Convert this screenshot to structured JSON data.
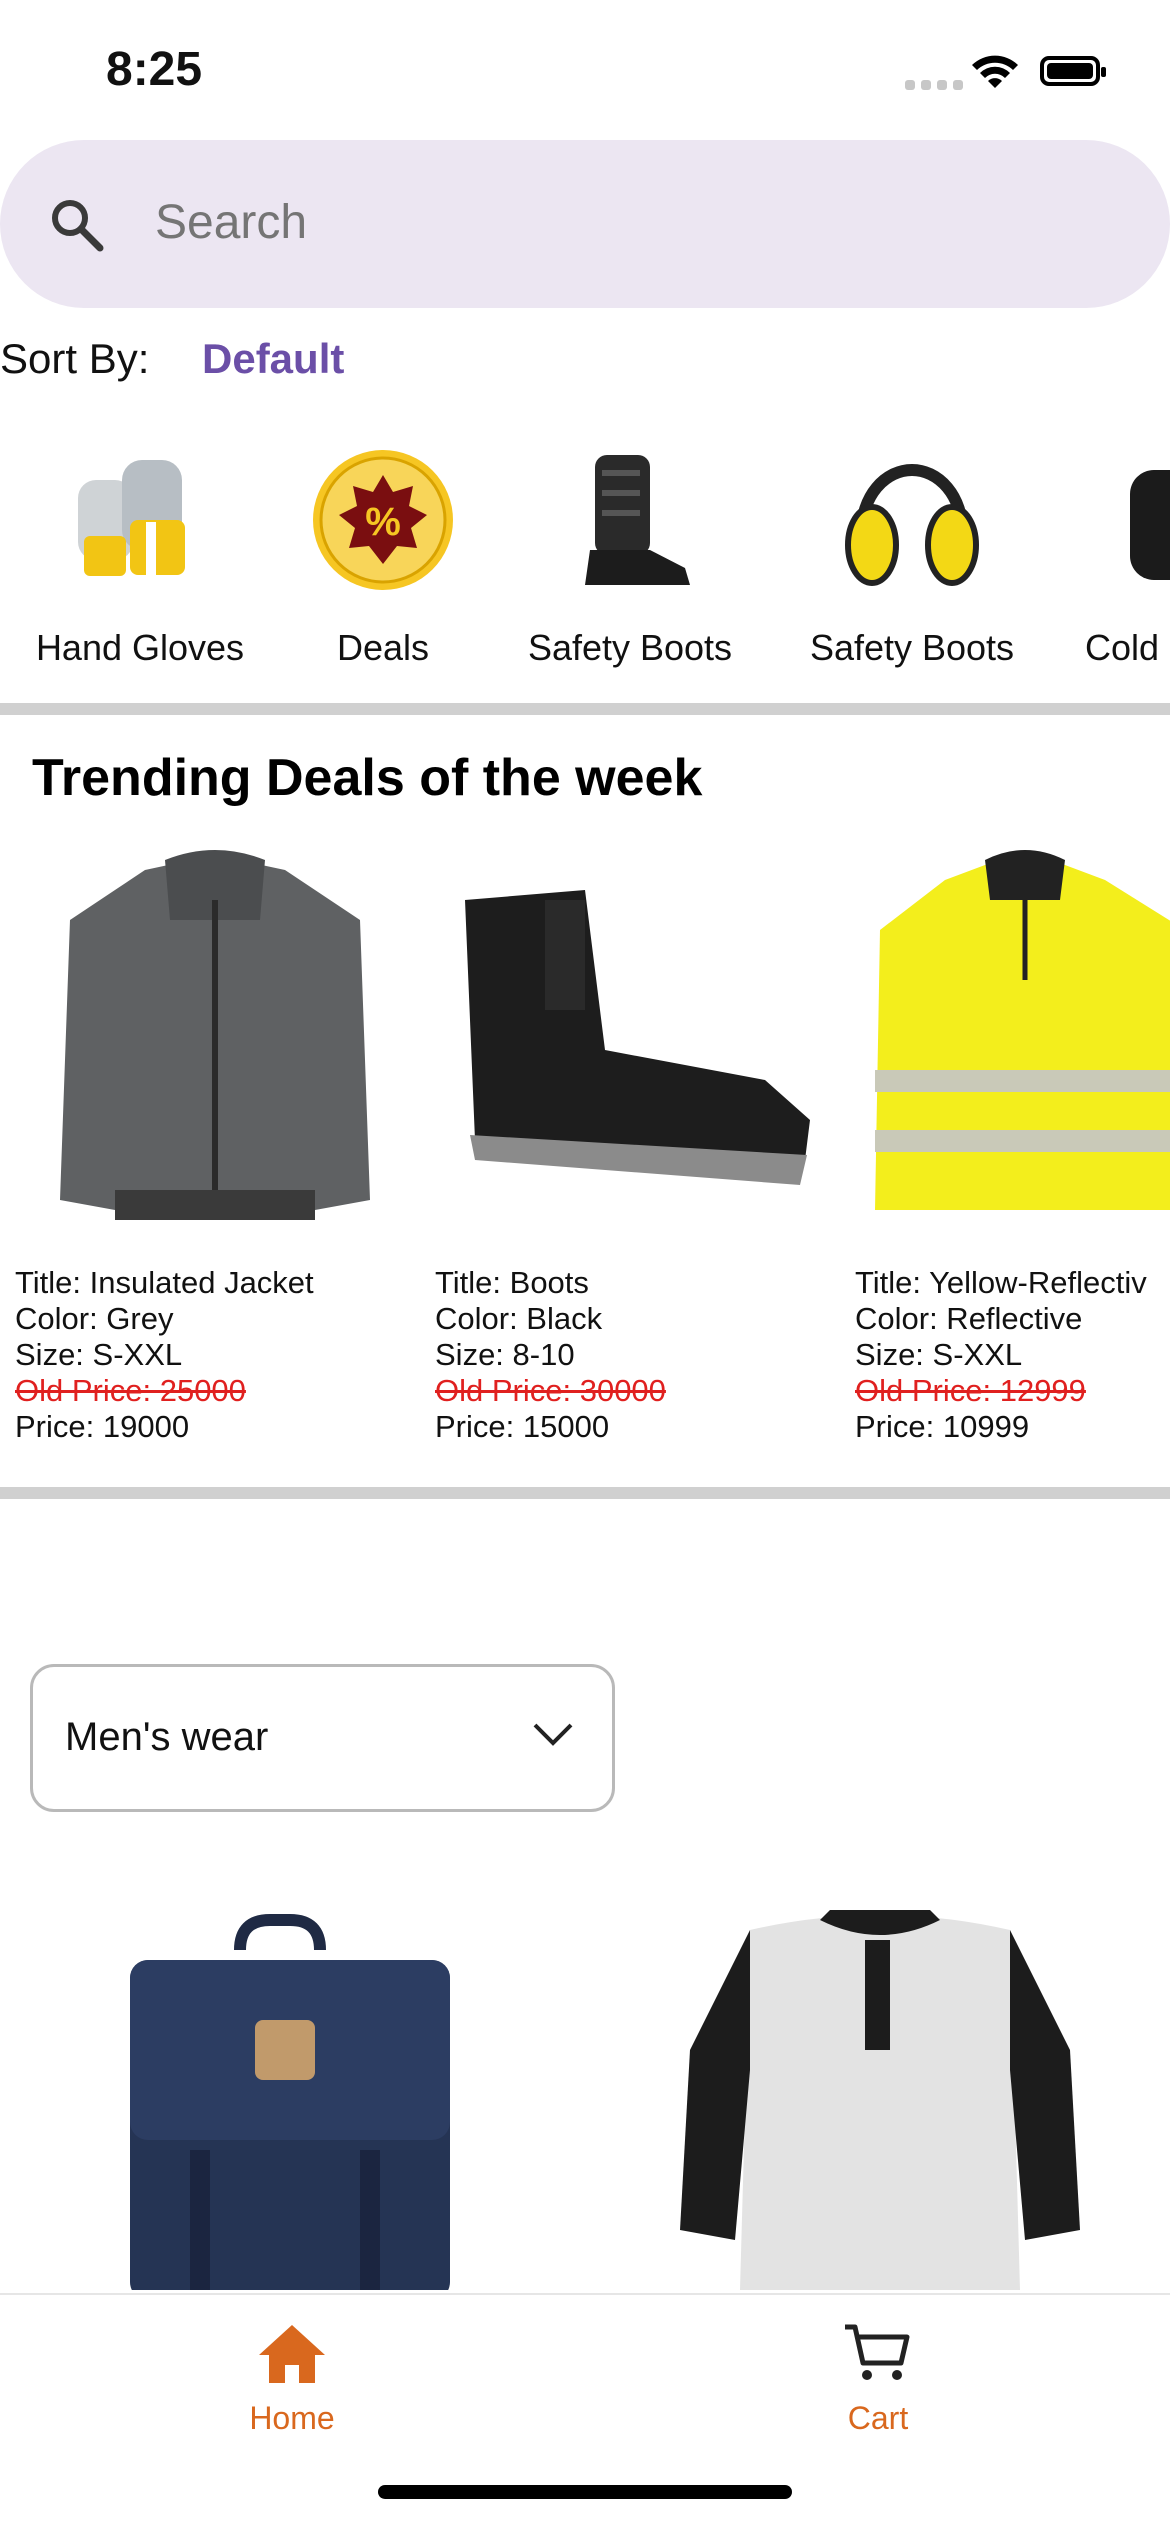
{
  "status_bar": {
    "time": "8:25"
  },
  "search": {
    "placeholder": "Search"
  },
  "sort": {
    "label": "Sort By:",
    "value": "Default"
  },
  "categories": [
    {
      "label": "Hand Gloves",
      "icon": "gloves-icon"
    },
    {
      "label": "Deals",
      "icon": "deals-badge-icon"
    },
    {
      "label": "Safety Boots",
      "icon": "safety-boot-icon"
    },
    {
      "label": "Safety Boots",
      "icon": "earmuffs-icon"
    },
    {
      "label": "Cold",
      "icon": "cold-glove-icon"
    }
  ],
  "trending": {
    "title": "Trending Deals of the week",
    "products": [
      {
        "title": "Title: Insulated Jacket",
        "color": "Color: Grey",
        "size": "Size: S-XXL",
        "old_price": "Old Price: 25000",
        "price": "Price: 19000"
      },
      {
        "title": "Title: Boots",
        "color": "Color: Black",
        "size": "Size: 8-10",
        "old_price": "Old Price: 30000",
        "price": "Price: 15000"
      },
      {
        "title": "Title: Yellow-Reflectiv",
        "color": "Color: Reflective",
        "size": "Size: S-XXL",
        "old_price": "Old Price: 12999",
        "price": "Price: 10999"
      }
    ]
  },
  "category_select": {
    "selected": "Men's wear"
  },
  "tabbar": {
    "home": "Home",
    "cart": "Cart"
  },
  "colors": {
    "accent": "#d9681e",
    "sort_value": "#6b4fa7",
    "old_price": "#e0201f",
    "search_bg": "#ece6f2"
  }
}
